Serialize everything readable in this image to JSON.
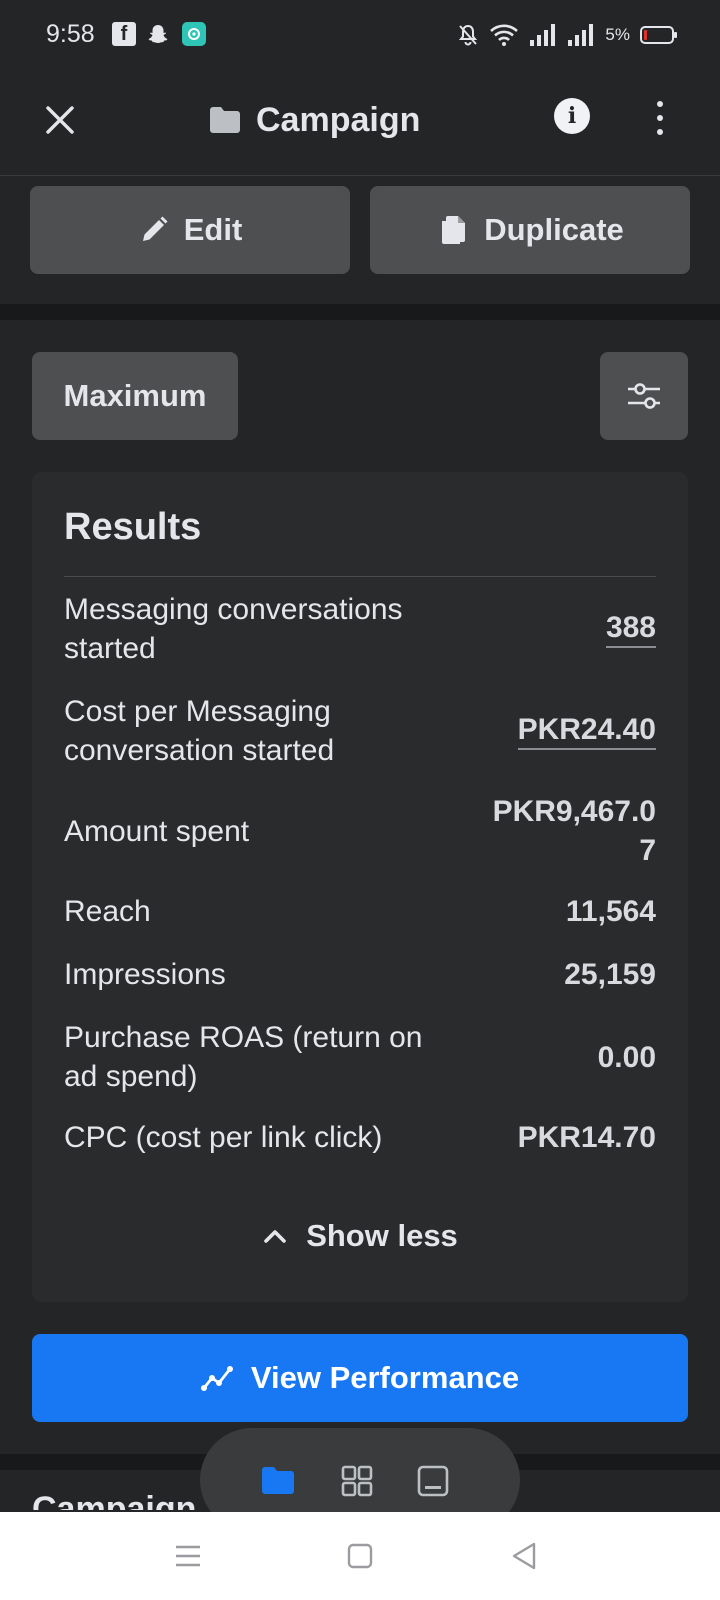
{
  "status_bar": {
    "time": "9:58",
    "battery_percent": "5%",
    "icons": [
      "facebook-icon",
      "snapchat-icon",
      "app-icon",
      "silent-bell-icon",
      "wifi-icon",
      "signal-icon",
      "signal-icon",
      "battery-icon"
    ]
  },
  "header": {
    "title": "Campaign",
    "icons": [
      "close-icon",
      "folder-icon",
      "info-icon",
      "more-icon"
    ]
  },
  "actions": {
    "edit_label": "Edit",
    "duplicate_label": "Duplicate"
  },
  "filter": {
    "range_label": "Maximum",
    "settings_icon": "sliders-icon"
  },
  "results": {
    "title": "Results",
    "metrics": [
      {
        "label": "Messaging conversations started",
        "value": "388"
      },
      {
        "label": "Cost per Messaging conversation started",
        "value": "PKR24.40"
      },
      {
        "label": "Amount spent",
        "value": "PKR9,467.07"
      },
      {
        "label": "Reach",
        "value": "11,564"
      },
      {
        "label": "Impressions",
        "value": "25,159"
      },
      {
        "label": "Purchase ROAS (return on ad spend)",
        "value": "0.00"
      },
      {
        "label": "CPC (cost per link click)",
        "value": "PKR14.70"
      }
    ],
    "toggle_label": "Show less"
  },
  "primary_button": {
    "label": "View Performance"
  },
  "next_section_peek": "Campaign",
  "bottom_tabs": [
    "folder-icon",
    "grid-icon",
    "ad-preview-icon"
  ],
  "colors": {
    "background": "#242526",
    "card": "#2a2b2c",
    "button_grey": "#4e4f50",
    "accent_blue": "#1877f2"
  }
}
